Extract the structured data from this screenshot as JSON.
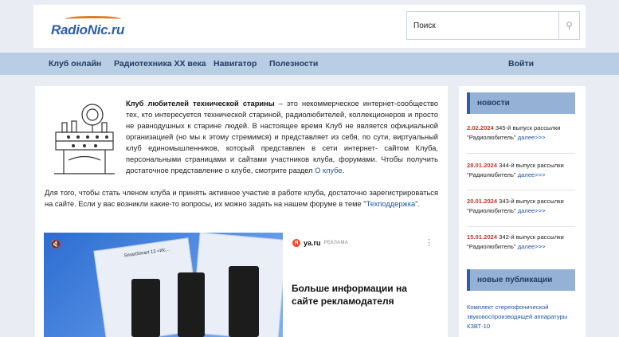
{
  "header": {
    "logo_text": "RadioNic.ru",
    "search_placeholder": "Поиск"
  },
  "nav": {
    "items": [
      "Клуб онлайн",
      "Радиотехника XX века",
      "Навигатор",
      "Полезности"
    ],
    "login": "Войти"
  },
  "main": {
    "intro_bold": "Клуб любителей технической старины",
    "intro_text": " – это некоммерческое интернет-сообщество тех, кто интересуется технической стариной, радиолюбителей, коллекционеров и просто не равнодушных к старине людей. В настоящее время Клуб не является официальной организацией (но мы к этому стремимся) и представляет из себя, по сути, виртуальный клуб единомышленников, который представлен в сети интернет- сайтом Клуба, персональными страницами и сайтами участников клуба, форумами. Чтобы получить достаточное представление о клубе, смотрите раздел ",
    "intro_link": "О клубе",
    "intro_end": ".",
    "join_text": "Для того, чтобы стать членом клуба и принять активное участие в работе клуба, достаточно зарегистрироваться на сайте. Если у вас возникли какие-то вопросы, их можно задать на нашем форуме в теме ",
    "join_quote_open": "\"",
    "join_link": "Техподдержка",
    "join_end": "\"."
  },
  "ad": {
    "badge_letter": "Я",
    "domain": "ya.ru",
    "label": "Реклама",
    "title": "Больше информации на сайте рекламодателя",
    "card_text": "SmartSmart 13 «Ис..."
  },
  "sidebar": {
    "news_heading": "новости",
    "news": [
      {
        "date": "2.02.2024",
        "text": " 345-й выпуск рассылки \"Радиолюбитель\" ",
        "link": "далее>>>"
      },
      {
        "date": "28.01.2024",
        "text": " 344-й выпуск рассылки \"Радиолюбитель\" ",
        "link": "далее>>>"
      },
      {
        "date": "20.01.2024",
        "text": " 343-й выпуск рассылки \"Радиолюбитель\" ",
        "link": "далее>>>"
      },
      {
        "date": "15.01.2024",
        "text": " 342-й выпуск рассылки \"Радиолюбитель\" ",
        "link": "далее>>>"
      }
    ],
    "pubs_heading": "новые публикации",
    "pub_item": "Комплект стереофонической звуковоспроизводящей аппаратуры КЗВТ-10"
  }
}
